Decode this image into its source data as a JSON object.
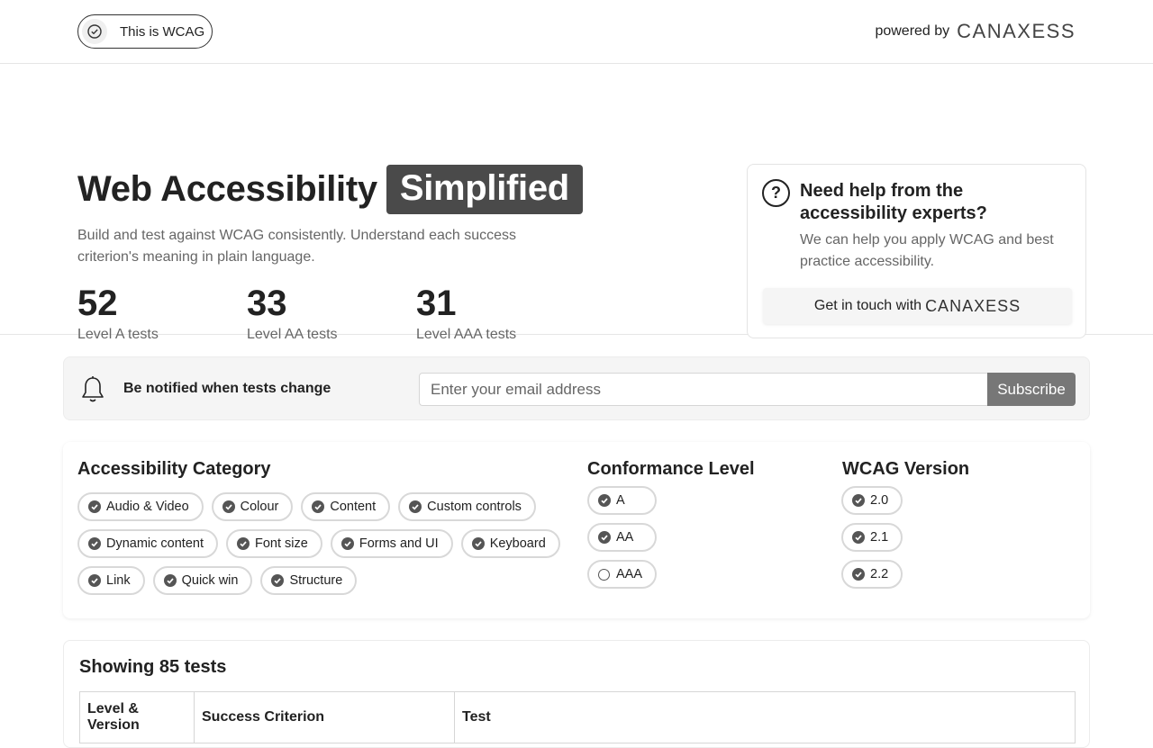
{
  "header": {
    "wcag_pill": "This is WCAG",
    "powered_by": "powered by",
    "brand": "CANAXESS"
  },
  "hero": {
    "title": "Web Accessibility",
    "title_highlight": "Simplified",
    "subtitle": "Build and test against WCAG consistently. Understand each success criterion's meaning in plain language.",
    "stats": [
      {
        "value": "52",
        "label": "Level A tests"
      },
      {
        "value": "33",
        "label": "Level AA tests"
      },
      {
        "value": "31",
        "label": "Level AAA tests"
      }
    ]
  },
  "help_card": {
    "title": "Need help from the accessibility experts?",
    "body": "We can help you apply WCAG and best practice accessibility.",
    "cta_label": "Get in touch with",
    "cta_brand": "CANAXESS"
  },
  "notify": {
    "text": "Be notified when tests change",
    "email_placeholder": "Enter your email address",
    "subscribe_label": "Subscribe"
  },
  "filters": {
    "category": {
      "title": "Accessibility Category",
      "chips": [
        {
          "label": "Audio & Video",
          "checked": true
        },
        {
          "label": "Colour",
          "checked": true
        },
        {
          "label": "Content",
          "checked": true
        },
        {
          "label": "Custom controls",
          "checked": true
        },
        {
          "label": "Dynamic content",
          "checked": true
        },
        {
          "label": "Font size",
          "checked": true
        },
        {
          "label": "Forms and UI",
          "checked": true
        },
        {
          "label": "Keyboard",
          "checked": true
        },
        {
          "label": "Link",
          "checked": true
        },
        {
          "label": "Quick win",
          "checked": true
        },
        {
          "label": "Structure",
          "checked": true
        }
      ]
    },
    "conformance": {
      "title": "Conformance Level",
      "chips": [
        {
          "label": "A",
          "checked": true
        },
        {
          "label": "AA",
          "checked": true
        },
        {
          "label": "AAA",
          "checked": false
        }
      ]
    },
    "version": {
      "title": "WCAG Version",
      "chips": [
        {
          "label": "2.0",
          "checked": true
        },
        {
          "label": "2.1",
          "checked": true
        },
        {
          "label": "2.2",
          "checked": true
        }
      ]
    }
  },
  "results": {
    "heading": "Showing 85 tests",
    "columns": [
      "Level & Version",
      "Success Criterion",
      "Test"
    ]
  },
  "colors": {
    "highlight_bg": "#4a4a4a",
    "subscribe_bg": "#777777",
    "check_fill": "#555555"
  }
}
